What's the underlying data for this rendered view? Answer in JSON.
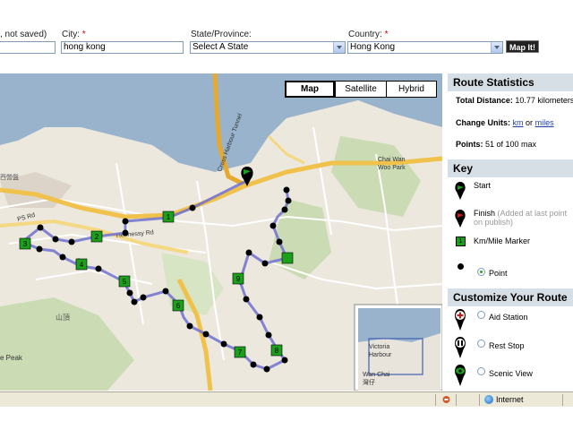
{
  "form": {
    "title_fragment": ", not saved)",
    "city_label": "City:",
    "city_value": "hong kong",
    "state_label": "State/Province:",
    "state_value": "Select A State",
    "country_label": "Country:",
    "country_value": "Hong Kong",
    "required_mark": "*",
    "map_it_label": "Map It!"
  },
  "map": {
    "type_buttons": [
      "Map",
      "Satellite",
      "Hybrid"
    ],
    "active_type": "Map",
    "markers": [
      "1",
      "2",
      "3",
      "4",
      "5",
      "6",
      "7",
      "8",
      "9"
    ],
    "place_labels": {
      "tunnel": "Cross Harbour Tunnel",
      "chai_wan_park": "Chai Wan",
      "woo_park": "Woo Park",
      "peak": "e Peak",
      "ps_rd": "PS Rd",
      "hennessy": "Hennessy Rd",
      "victoria": "Victoria",
      "harbour": "Harbour",
      "wan_chai": "Wan Chai",
      "wan_chai_cn": "灣仔",
      "cn_1": "山頂",
      "cn_2": "西營盤"
    }
  },
  "panel": {
    "route_stats_title": "Route Statistics",
    "total_distance_label": "Total Distance:",
    "total_distance_value": "10.77 kilometers",
    "change_units_label": "Change Units:",
    "unit_km": "km",
    "unit_or": "or",
    "unit_miles": "miles",
    "points_label": "Points:",
    "points_value": "51 of 100 max",
    "key_title": "Key",
    "key_start": "Start",
    "key_finish": "Finish",
    "key_finish_note": "(Added at last point on publish)",
    "key_marker": "Km/Mile Marker",
    "key_point": "Point",
    "customize_title": "Customize Your Route",
    "aid_station": "Aid Station",
    "rest_stop": "Rest Stop",
    "scenic_view": "Scenic View"
  },
  "status": {
    "zone": "Internet"
  },
  "colors": {
    "route": "#7070d0",
    "marker": "#1aa01a",
    "water": "#99b3cc",
    "panel_header": "#d7dfe6"
  }
}
